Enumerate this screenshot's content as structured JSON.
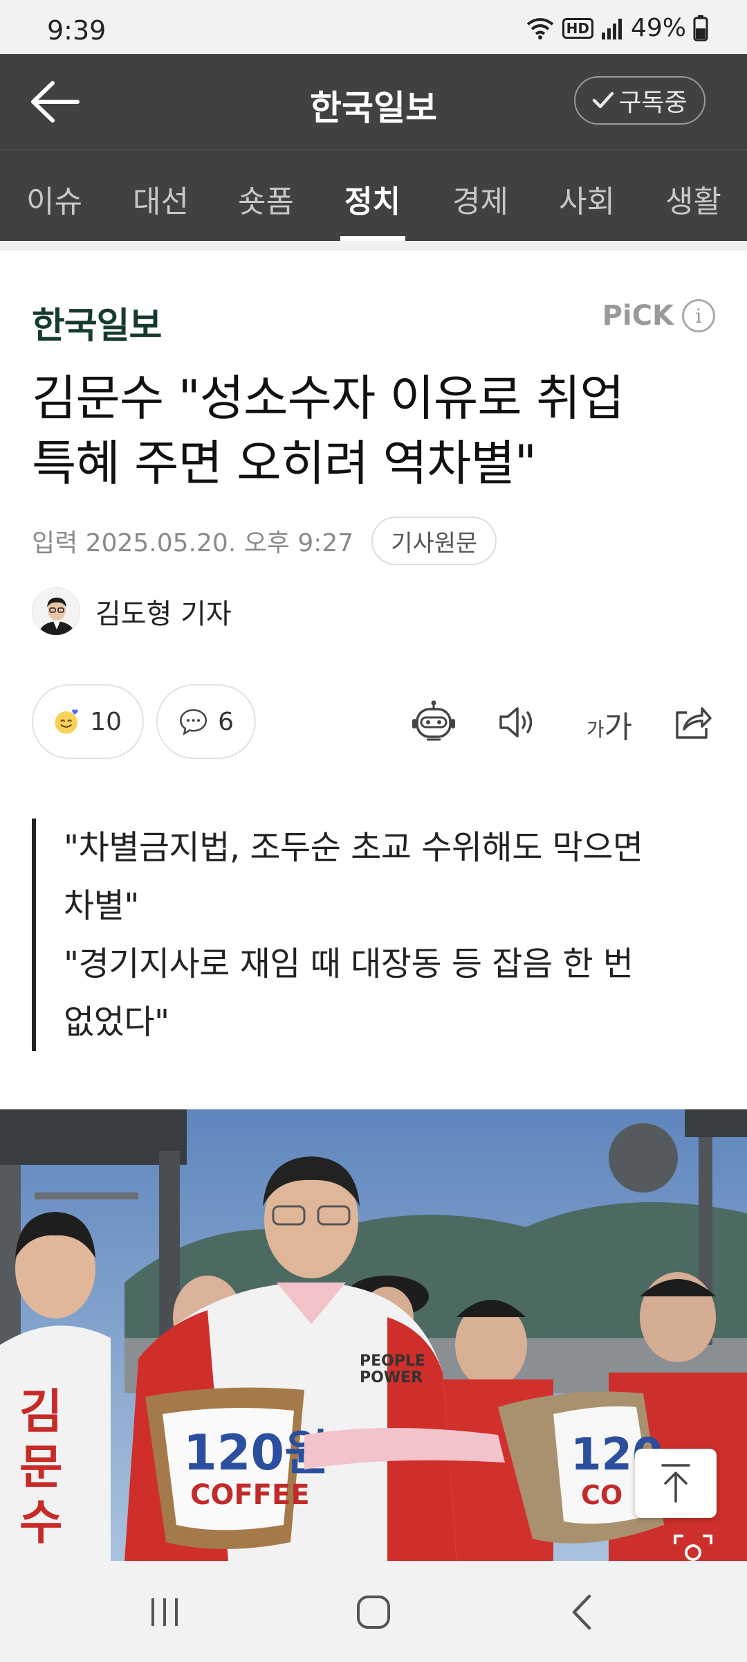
{
  "status_bar": {
    "time": "9:39",
    "battery": "49%",
    "hd_label": "HD"
  },
  "header": {
    "title": "한국일보",
    "subscribe_label": "구독중"
  },
  "categories": [
    {
      "label": "이슈",
      "active": false
    },
    {
      "label": "대선",
      "active": false
    },
    {
      "label": "숏폼",
      "active": false
    },
    {
      "label": "정치",
      "active": true
    },
    {
      "label": "경제",
      "active": false
    },
    {
      "label": "사회",
      "active": false
    },
    {
      "label": "생활",
      "active": false
    }
  ],
  "article": {
    "press_logo": "한국일보",
    "pick_label": "PiCK",
    "pick_info": "i",
    "headline_line1": "김문수 \"성소수자 이유로 취업",
    "headline_line2": "특혜 주면 오히려 역차별\"",
    "date": "입력 2025.05.20. 오후 9:27",
    "original_button": "기사원문",
    "reporter": "김도형 기자",
    "reaction_count": "10",
    "comment_count": "6",
    "font_small": "가",
    "font_large": "가",
    "summary": [
      "\"차별금지법, 조두순 초교 수위해도 막으면",
      "차별\"",
      "\"경기지사로 재임 때 대장동 등 잡음 한 번",
      "없었다\""
    ]
  },
  "photo": {
    "cup_label_1": "120원",
    "cup_sub_1": "COFFEE",
    "cup_label_2": "120",
    "cup_sub_2": "CO",
    "vest_name": "김문수",
    "logo_text": "PEOPLE POWER"
  },
  "colors": {
    "header_bg": "#404142",
    "press_green": "#173b2e",
    "pick_gray": "#9a9a9a"
  }
}
